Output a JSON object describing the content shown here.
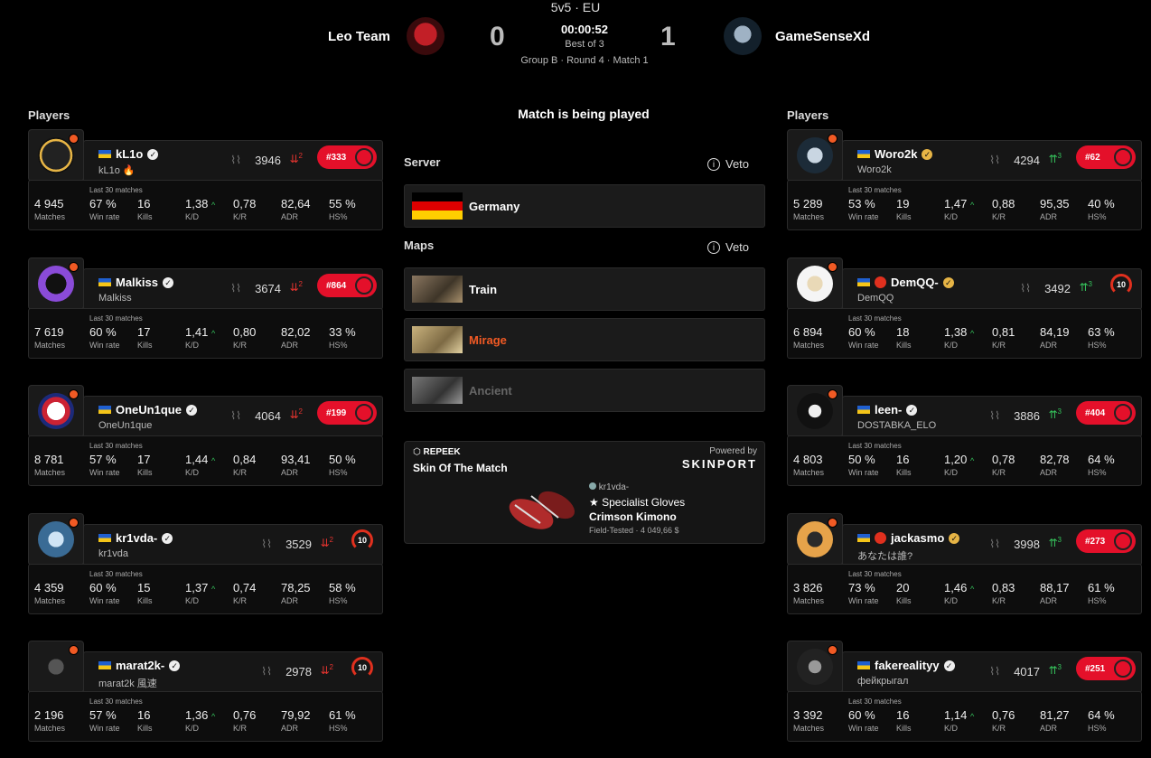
{
  "header": {
    "mode": "5v5 · EU",
    "team_left": "Leo Team",
    "team_right": "GameSenseXd",
    "score_left": "0",
    "score_right": "1",
    "timer": "00:00:52",
    "best_of": "Best of 3",
    "round_info": "Group B · Round 4 · Match 1"
  },
  "left_title": "Players",
  "right_title": "Players",
  "center": {
    "status": "Match is being played",
    "server_title": "Server",
    "veto_label": "Veto",
    "server_name": "Germany",
    "maps_title": "Maps",
    "maps": [
      {
        "name": "Train",
        "color": "#ffffff"
      },
      {
        "name": "Mirage",
        "color": "#f15a24"
      },
      {
        "name": "Ancient",
        "color": "#666666"
      }
    ],
    "skin": {
      "brand": "REPEEK",
      "title": "Skin Of The Match",
      "powered_by": "Powered by",
      "provider": "SKINPORT",
      "owner": "kr1vda-",
      "item_line1": "★ Specialist Gloves",
      "item_line2": "Crimson Kimono",
      "condition_price": "Field-Tested · 4 049,66 $"
    }
  },
  "stat_labels": {
    "last30": "Last 30 matches",
    "matches": "Matches",
    "winrate": "Win rate",
    "kills": "Kills",
    "kd": "K/D",
    "kr": "K/R",
    "adr": "ADR",
    "hs": "HS%"
  },
  "left_players": [
    {
      "name": "kL1o",
      "sub": "kL1o 🔥",
      "elo": "3946",
      "trend": "2",
      "rank": "#333",
      "level": "",
      "matches": "4 945",
      "winrate": "67 %",
      "kills": "16",
      "kd": "1,38",
      "kr": "0,78",
      "adr": "82,64",
      "hs": "55 %"
    },
    {
      "name": "Malkiss",
      "sub": "Malkiss",
      "elo": "3674",
      "trend": "2",
      "rank": "#864",
      "level": "",
      "matches": "7 619",
      "winrate": "60 %",
      "kills": "17",
      "kd": "1,41",
      "kr": "0,80",
      "adr": "82,02",
      "hs": "33 %"
    },
    {
      "name": "OneUn1que",
      "sub": "OneUn1que",
      "elo": "4064",
      "trend": "2",
      "rank": "#199",
      "level": "",
      "matches": "8 781",
      "winrate": "57 %",
      "kills": "17",
      "kd": "1,44",
      "kr": "0,84",
      "adr": "93,41",
      "hs": "50 %"
    },
    {
      "name": "kr1vda-",
      "sub": "kr1vda",
      "elo": "3529",
      "trend": "2",
      "rank": "",
      "level": "10",
      "matches": "4 359",
      "winrate": "60 %",
      "kills": "15",
      "kd": "1,37",
      "kr": "0,74",
      "adr": "78,25",
      "hs": "58 %"
    },
    {
      "name": "marat2k-",
      "sub": "marat2k 風速",
      "elo": "2978",
      "trend": "2",
      "rank": "",
      "level": "10",
      "matches": "2 196",
      "winrate": "57 %",
      "kills": "16",
      "kd": "1,36",
      "kr": "0,76",
      "adr": "79,92",
      "hs": "61 %"
    }
  ],
  "right_players": [
    {
      "name": "Woro2k",
      "sub": "Woro2k",
      "elo": "4294",
      "trend": "3",
      "rank": "#62",
      "level": "",
      "matches": "5 289",
      "winrate": "53 %",
      "kills": "19",
      "kd": "1,47",
      "kr": "0,88",
      "adr": "95,35",
      "hs": "40 %"
    },
    {
      "name": "DemQQ-",
      "sub": "DemQQ",
      "elo": "3492",
      "trend": "3",
      "rank": "",
      "level": "10",
      "matches": "6 894",
      "winrate": "60 %",
      "kills": "18",
      "kd": "1,38",
      "kr": "0,81",
      "adr": "84,19",
      "hs": "63 %"
    },
    {
      "name": "leen-",
      "sub": "DOSTABKA_ELO",
      "elo": "3886",
      "trend": "3",
      "rank": "#404",
      "level": "",
      "matches": "4 803",
      "winrate": "50 %",
      "kills": "16",
      "kd": "1,20",
      "kr": "0,78",
      "adr": "82,78",
      "hs": "64 %"
    },
    {
      "name": "jackasmo",
      "sub": "あなたは誰?",
      "elo": "3998",
      "trend": "3",
      "rank": "#273",
      "level": "",
      "matches": "3 826",
      "winrate": "73 %",
      "kills": "20",
      "kd": "1,46",
      "kr": "0,83",
      "adr": "88,17",
      "hs": "61 %"
    },
    {
      "name": "fakerealityy",
      "sub": "фейкрыгал",
      "elo": "4017",
      "trend": "3",
      "rank": "#251",
      "level": "",
      "matches": "3 392",
      "winrate": "60 %",
      "kills": "16",
      "kd": "1,14",
      "kr": "0,76",
      "adr": "81,27",
      "hs": "64 %"
    }
  ]
}
